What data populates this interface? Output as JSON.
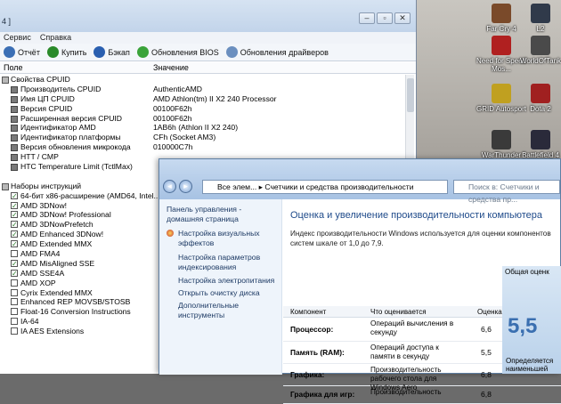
{
  "desktop": {
    "icons": [
      {
        "label": "Far Cry 4",
        "color": "#7a4a2a"
      },
      {
        "label": "L2",
        "color": "#303a4a"
      },
      {
        "label": "Need for Speed Mos...",
        "color": "#b02020"
      },
      {
        "label": "WorldOfTank",
        "color": "#4a4a4a"
      },
      {
        "label": "GRID Autosport",
        "color": "#c0a020"
      },
      {
        "label": "Dota 2",
        "color": "#a02020"
      },
      {
        "label": "WarThunder",
        "color": "#3a3a3a"
      },
      {
        "label": "Battlefield 4",
        "color": "#2a2a3a"
      }
    ]
  },
  "aida": {
    "title": "4 ]",
    "window_buttons": [
      "–",
      "▫",
      "✕"
    ],
    "menu": [
      "Сервис",
      "Справка"
    ],
    "toolbar": [
      {
        "label": "Отчёт",
        "icon": "report-icon",
        "color": "#3b6fb5"
      },
      {
        "label": "Купить",
        "icon": "buy-icon",
        "color": "#2a8a2a"
      },
      {
        "label": "Бэкап",
        "icon": "backup-icon",
        "color": "#2a5fb0"
      },
      {
        "label": "Обновления BIOS",
        "icon": "bios-update-icon",
        "color": "#3aa33a"
      },
      {
        "label": "Обновления драйверов",
        "icon": "driver-update-icon",
        "color": "#6b8fbf"
      }
    ],
    "columns": {
      "field": "Поле",
      "value": "Значение"
    },
    "rows": [
      {
        "kind": "section",
        "label": "Свойства CPUID",
        "value": ""
      },
      {
        "kind": "item",
        "label": "Производитель CPUID",
        "value": "AuthenticAMD"
      },
      {
        "kind": "item",
        "label": "Имя ЦП CPUID",
        "value": "AMD Athlon(tm) II X2 240 Processor"
      },
      {
        "kind": "item",
        "label": "Версия CPUID",
        "value": "00100F62h"
      },
      {
        "kind": "item",
        "label": "Расширенная версия CPUID",
        "value": "00100F62h"
      },
      {
        "kind": "item",
        "label": "Идентификатор AMD",
        "value": "1AB6h  (Athlon II X2 240)"
      },
      {
        "kind": "item",
        "label": "Идентификатор платформы",
        "value": "CFh  (Socket AM3)"
      },
      {
        "kind": "item",
        "label": "Версия обновления микрокода",
        "value": "010000C7h"
      },
      {
        "kind": "item",
        "label": "HTT / CMP",
        "value": ""
      },
      {
        "kind": "item",
        "label": "HTC Temperature Limit (TctlMax)",
        "value": ""
      },
      {
        "kind": "blank",
        "label": "",
        "value": ""
      },
      {
        "kind": "section",
        "label": "Наборы инструкций",
        "value": ""
      },
      {
        "kind": "check",
        "checked": true,
        "label": "64-бит x86-расширение (AMD64, Intel...",
        "value": ""
      },
      {
        "kind": "check",
        "checked": true,
        "label": "AMD 3DNow!",
        "value": ""
      },
      {
        "kind": "check",
        "checked": true,
        "label": "AMD 3DNow! Professional",
        "value": ""
      },
      {
        "kind": "check",
        "checked": true,
        "label": "AMD 3DNowPrefetch",
        "value": ""
      },
      {
        "kind": "check",
        "checked": true,
        "label": "AMD Enhanced 3DNow!",
        "value": ""
      },
      {
        "kind": "check",
        "checked": true,
        "label": "AMD Extended MMX",
        "value": ""
      },
      {
        "kind": "check",
        "checked": false,
        "label": "AMD FMA4",
        "value": ""
      },
      {
        "kind": "check",
        "checked": true,
        "label": "AMD MisAligned SSE",
        "value": ""
      },
      {
        "kind": "check",
        "checked": true,
        "label": "AMD SSE4A",
        "value": ""
      },
      {
        "kind": "check",
        "checked": false,
        "label": "AMD XOP",
        "value": ""
      },
      {
        "kind": "check",
        "checked": false,
        "label": "Cyrix Extended MMX",
        "value": ""
      },
      {
        "kind": "check",
        "checked": false,
        "label": "Enhanced REP MOVSB/STOSB",
        "value": ""
      },
      {
        "kind": "check",
        "checked": false,
        "label": "Float-16 Conversion Instructions",
        "value": ""
      },
      {
        "kind": "check",
        "checked": false,
        "label": "IA-64",
        "value": ""
      },
      {
        "kind": "check",
        "checked": false,
        "label": "IA AES Extensions",
        "value": ""
      }
    ]
  },
  "perf": {
    "address": "Все элем...  ▸  Счетчики и средства производительности",
    "search_placeholder": "Поиск в: Счетчики и средства пр...",
    "left_links": [
      "Панель управления - домашняя страница",
      "Настройка визуальных эффектов",
      "Настройка параметров индексирования",
      "Настройка электропитания",
      "Открыть очистку диска",
      "Дополнительные инструменты"
    ],
    "title": "Оценка и увеличение производительности компьютера",
    "description": "Индекс производительности Windows используется для оценки компонентов систем шкале от 1,0 до 7,9.",
    "table_headers": {
      "component": "Компонент",
      "what": "Что оценивается",
      "score": "Оценка",
      "base": "Общая оценк"
    },
    "table_rows": [
      {
        "component": "Процессор:",
        "what": "Операций вычисления в секунду",
        "score": "6,6"
      },
      {
        "component": "Память (RAM):",
        "what": "Операций доступа к памяти в секунду",
        "score": "5,5"
      },
      {
        "component": "Графика:",
        "what": "Производительность рабочего стола для Windows Aero",
        "score": "6,8"
      },
      {
        "component": "Графика для игр:",
        "what": "Производительность",
        "score": "6,8"
      }
    ],
    "base_score": "5,5",
    "base_caption": "Определяется наименьшей"
  }
}
